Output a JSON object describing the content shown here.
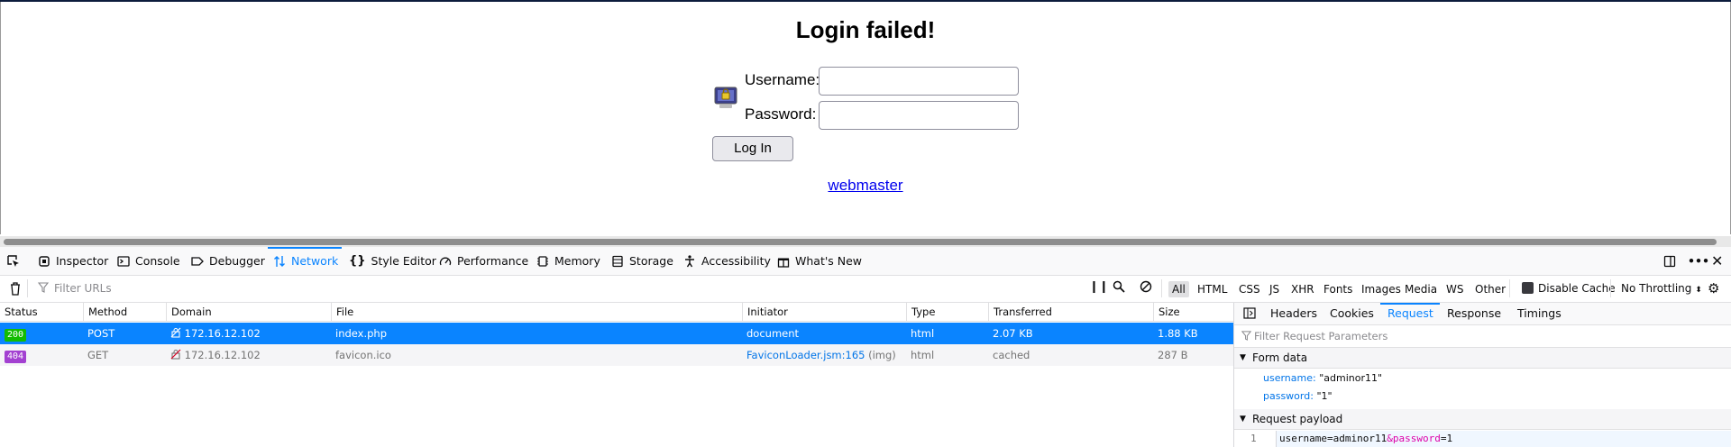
{
  "page": {
    "title": "Login failed!",
    "username_label": "Username:",
    "password_label": "Password:",
    "username_value": "",
    "password_value": "",
    "login_button": "Log In",
    "webmaster_link": "webmaster"
  },
  "devtools": {
    "tabs": [
      {
        "label": "Inspector"
      },
      {
        "label": "Console"
      },
      {
        "label": "Debugger"
      },
      {
        "label": "Network"
      },
      {
        "label": "Style Editor"
      },
      {
        "label": "Performance"
      },
      {
        "label": "Memory"
      },
      {
        "label": "Storage"
      },
      {
        "label": "Accessibility"
      },
      {
        "label": "What's New"
      }
    ],
    "selected_tab": "Network",
    "toolbar": {
      "filter_placeholder": "Filter URLs",
      "types": [
        "All",
        "HTML",
        "CSS",
        "JS",
        "XHR",
        "Fonts",
        "Images",
        "Media",
        "WS",
        "Other"
      ],
      "selected_type": "All",
      "disable_cache_label": "Disable Cache",
      "throttling_label": "No Throttling"
    },
    "columns": [
      "Status",
      "Method",
      "Domain",
      "File",
      "Initiator",
      "Type",
      "Transferred",
      "Size"
    ],
    "rows": [
      {
        "status": "200",
        "method": "POST",
        "domain": "172.16.12.102",
        "file": "index.php",
        "initiator": "document",
        "initiator_extra": "",
        "type": "html",
        "transferred": "2.07 KB",
        "size": "1.88 KB"
      },
      {
        "status": "404",
        "method": "GET",
        "domain": "172.16.12.102",
        "file": "favicon.ico",
        "initiator": "FaviconLoader.jsm:165",
        "initiator_extra": "(img)",
        "type": "html",
        "transferred": "cached",
        "size": "287 B"
      }
    ],
    "status_colors": {
      "200": "#12bc00",
      "404": "#a341d1"
    },
    "side_panel": {
      "tabs": [
        "Headers",
        "Cookies",
        "Request",
        "Response",
        "Timings"
      ],
      "selected_tab": "Request",
      "filter_placeholder": "Filter Request Parameters",
      "form_data_title": "Form data",
      "form_data": [
        {
          "key": "username:",
          "value": "\"adminor11\""
        },
        {
          "key": "password:",
          "value": "\"1\""
        }
      ],
      "payload_title": "Request payload",
      "payload_line_no": "1",
      "payload_parts": {
        "k1": "username",
        "eq1": "=",
        "v1": "adminor11",
        "amp": "&",
        "k2": "password",
        "eq2": "=",
        "v2": "1"
      }
    },
    "accent_color": "#0a84ff"
  }
}
